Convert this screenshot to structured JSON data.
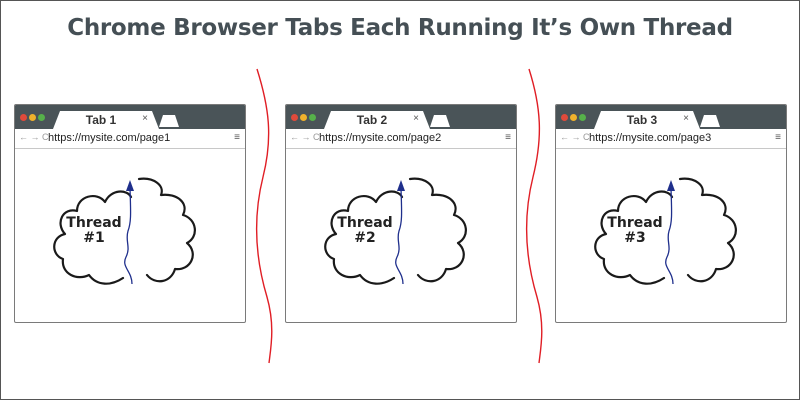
{
  "title": "Chrome Browser Tabs Each Running It’s Own Thread",
  "colors": {
    "title": "#454f55",
    "tabbar": "#4a5458",
    "divider": "#e01e25",
    "thread_arrow": "#1f2f8c",
    "cloud_stroke": "#1a1a1a"
  },
  "icons": {
    "window_controls": [
      "red-dot",
      "yellow-dot",
      "green-dot"
    ],
    "navigation": "back-forward-reload-icons",
    "menu": "hamburger-menu-icon"
  },
  "browsers": [
    {
      "tab_label": "Tab 1",
      "tab_close": "×",
      "nav_glyphs": "← → C",
      "url": "https://mysite.com/page1",
      "menu_glyph": "≡",
      "thread_line1": "Thread",
      "thread_line2": "#1"
    },
    {
      "tab_label": "Tab 2",
      "tab_close": "×",
      "nav_glyphs": "← → C",
      "url": "https://mysite.com/page2",
      "menu_glyph": "≡",
      "thread_line1": "Thread",
      "thread_line2": "#2"
    },
    {
      "tab_label": "Tab 3",
      "tab_close": "×",
      "nav_glyphs": "← → C",
      "url": "https://mysite.com/page3",
      "menu_glyph": "≡",
      "thread_line1": "Thread",
      "thread_line2": "#3"
    }
  ]
}
